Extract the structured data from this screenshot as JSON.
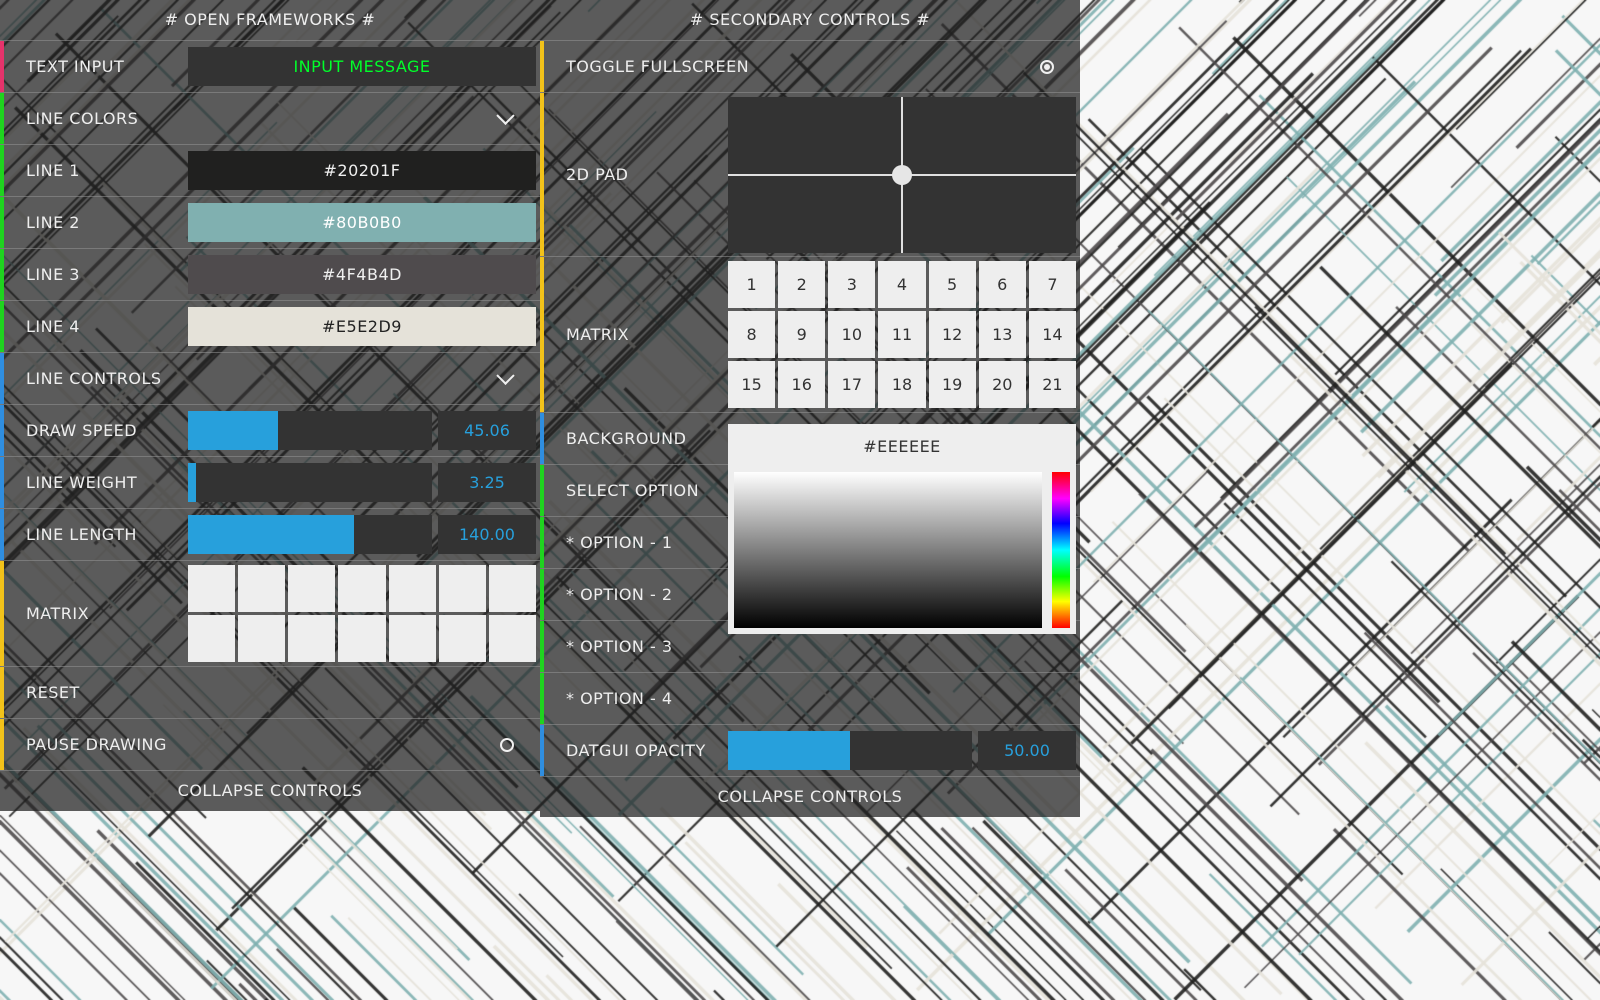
{
  "colors": {
    "accent_blue": "#27a0dc",
    "stripe_pink": "#e5336b",
    "stripe_green": "#1fd31f",
    "stripe_blue": "#2f8ee0",
    "stripe_yellow": "#f2c21a",
    "input_green": "#00ff2a"
  },
  "left": {
    "header": "# OPEN FRAMEWORKS #",
    "text_input": {
      "label": "TEXT INPUT",
      "value": "INPUT MESSAGE"
    },
    "line_colors": {
      "label": "LINE COLORS"
    },
    "lines": [
      {
        "label": "LINE 1",
        "value": "#20201F",
        "bg": "#20201F",
        "fg": "#f0f0f0"
      },
      {
        "label": "LINE 2",
        "value": "#80B0B0",
        "bg": "#80B0B0",
        "fg": "#ffffff"
      },
      {
        "label": "LINE 3",
        "value": "#4F4B4D",
        "bg": "#4F4B4D",
        "fg": "#f0f0f0"
      },
      {
        "label": "LINE 4",
        "value": "#E5E2D9",
        "bg": "#E5E2D9",
        "fg": "#222222"
      }
    ],
    "line_controls": {
      "label": "LINE CONTROLS"
    },
    "sliders": [
      {
        "label": "DRAW SPEED",
        "value": "45.06",
        "fraction": 0.37
      },
      {
        "label": "LINE WEIGHT",
        "value": "3.25",
        "fraction": 0.03
      },
      {
        "label": "LINE LENGTH",
        "value": "140.00",
        "fraction": 0.68
      }
    ],
    "matrix": {
      "label": "MATRIX",
      "rows": 2,
      "cols": 7
    },
    "reset": {
      "label": "RESET"
    },
    "pause": {
      "label": "PAUSE DRAWING",
      "checked": false
    },
    "footer": "COLLAPSE CONTROLS"
  },
  "right": {
    "header": "# SECONDARY CONTROLS #",
    "fullscreen": {
      "label": "TOGGLE FULLSCREEN",
      "checked": true
    },
    "pad": {
      "label": "2D PAD"
    },
    "matrix": {
      "label": "MATRIX",
      "cells": [
        "1",
        "2",
        "3",
        "4",
        "5",
        "6",
        "7",
        "8",
        "9",
        "10",
        "11",
        "12",
        "13",
        "14",
        "15",
        "16",
        "17",
        "18",
        "19",
        "20",
        "21"
      ]
    },
    "background": {
      "label": "BACKGROUND",
      "value": "#EEEEEE"
    },
    "select_option": {
      "label": "SELECT OPTION"
    },
    "options": [
      "* OPTION - 1",
      "* OPTION - 2",
      "* OPTION - 3",
      "* OPTION - 4"
    ],
    "opacity": {
      "label": "DATGUI OPACITY",
      "value": "50.00",
      "fraction": 0.5
    },
    "footer": "COLLAPSE CONTROLS"
  }
}
